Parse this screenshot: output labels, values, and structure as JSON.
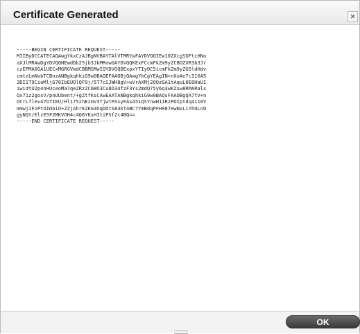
{
  "dialog": {
    "title": "Certificate Generated",
    "close_glyph": "×",
    "close_icon": "close-icon",
    "csr_text": "-----BEGIN CERTIFICATE REQUEST-----\nMIIByDCCATECAQAwgYkxCzAJBgNVBAYTAlVTMRYwFAYDVQQIEw10ZXcgSGFtcHNo\naXJlMRAwDgYDVQQHEwdDb25jb3JkMRowGAYDVQQKExFCcmFkZm9yZCBOZXR3b3Jr\nczEPMA0GA1UECxMGRGVwdCBBMSMwIQYDVQQDExpxYTIyOC5icmFkZm9yZG5ldHdv\ncmtzLmNvbTCBnzANBgkqhkiG9w0BAQEFAAOBjQAwgYkCgYEAgIN+nXoAe7cI16A5\n3DI1T9CioMljG70IbEUOlQF9j/5T7cSJWH8gV+wVrAXMj2QQzGA1tAquL0E0HaUI\niwidtU2p4nHUceoMa7qeZRzZC6WO3Cu8D34fzF3Ys2mdQ75y6q3wKZsw8RMARals\nQx71z2gosV/pnUUbent/+gZtfKsCAwEAATANBgkqhkiG9w0BAQsFAAOBgQA7tV+n\nOCrLflev47bTIEU/Hl175zhEzmV3TjwtPXxyFAsA51QSYnwH1IRzPOIptdq4110V\nmmwj1FzPtOImbiO+ZZjAhrE2KG3OqDOtS83kT4BC7YmBdqPFH987ewNxLiYhULnD\ngyNQt/ElzE5F2MKVOH4c4Q6YKsHItiPSf2c4BQ==\n-----END CERTIFICATE REQUEST-----",
    "ok_label": "OK"
  }
}
